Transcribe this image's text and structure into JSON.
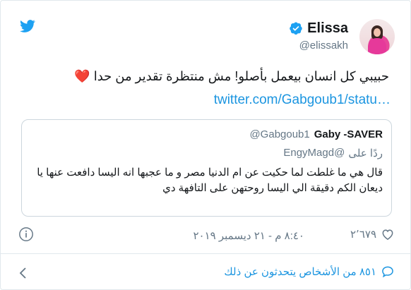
{
  "theme": {
    "accent": "#1b95e0",
    "heart": "#e0245e",
    "muted": "#657786",
    "border": "#e1e8ed"
  },
  "header": {
    "logo_icon": "twitter-bird-icon",
    "display_name": "Elissa",
    "handle": "@elissakh",
    "verified_icon": "verified-badge-icon"
  },
  "tweet": {
    "text": "حبيبي كل انسان بيعمل بأصلو! مش منتظرة تقدير من حدا",
    "emoji": "❤️",
    "link": "twitter.com/Gabgoub1/statu…"
  },
  "quote": {
    "display_name": "Gaby -SAVER",
    "handle": "@Gabgoub1",
    "reply_label": "ردًا على",
    "reply_to": "@EngyMagd",
    "text": "قال هي ما غلطت لما حكيت عن ام الدنيا مصر و ما عجبها انه اليسا دافعت عنها يا ديعان الكم دقيقة الي اليسا روحتهن على التافهة دي"
  },
  "meta": {
    "like_count": "٢٬٦٧٩",
    "timestamp": "٨:٤٠ م - ٢١ ديسمبر ٢٠١٩"
  },
  "footer": {
    "people_talking": "٨٥١ من الأشخاص يتحدثون عن ذلك"
  }
}
